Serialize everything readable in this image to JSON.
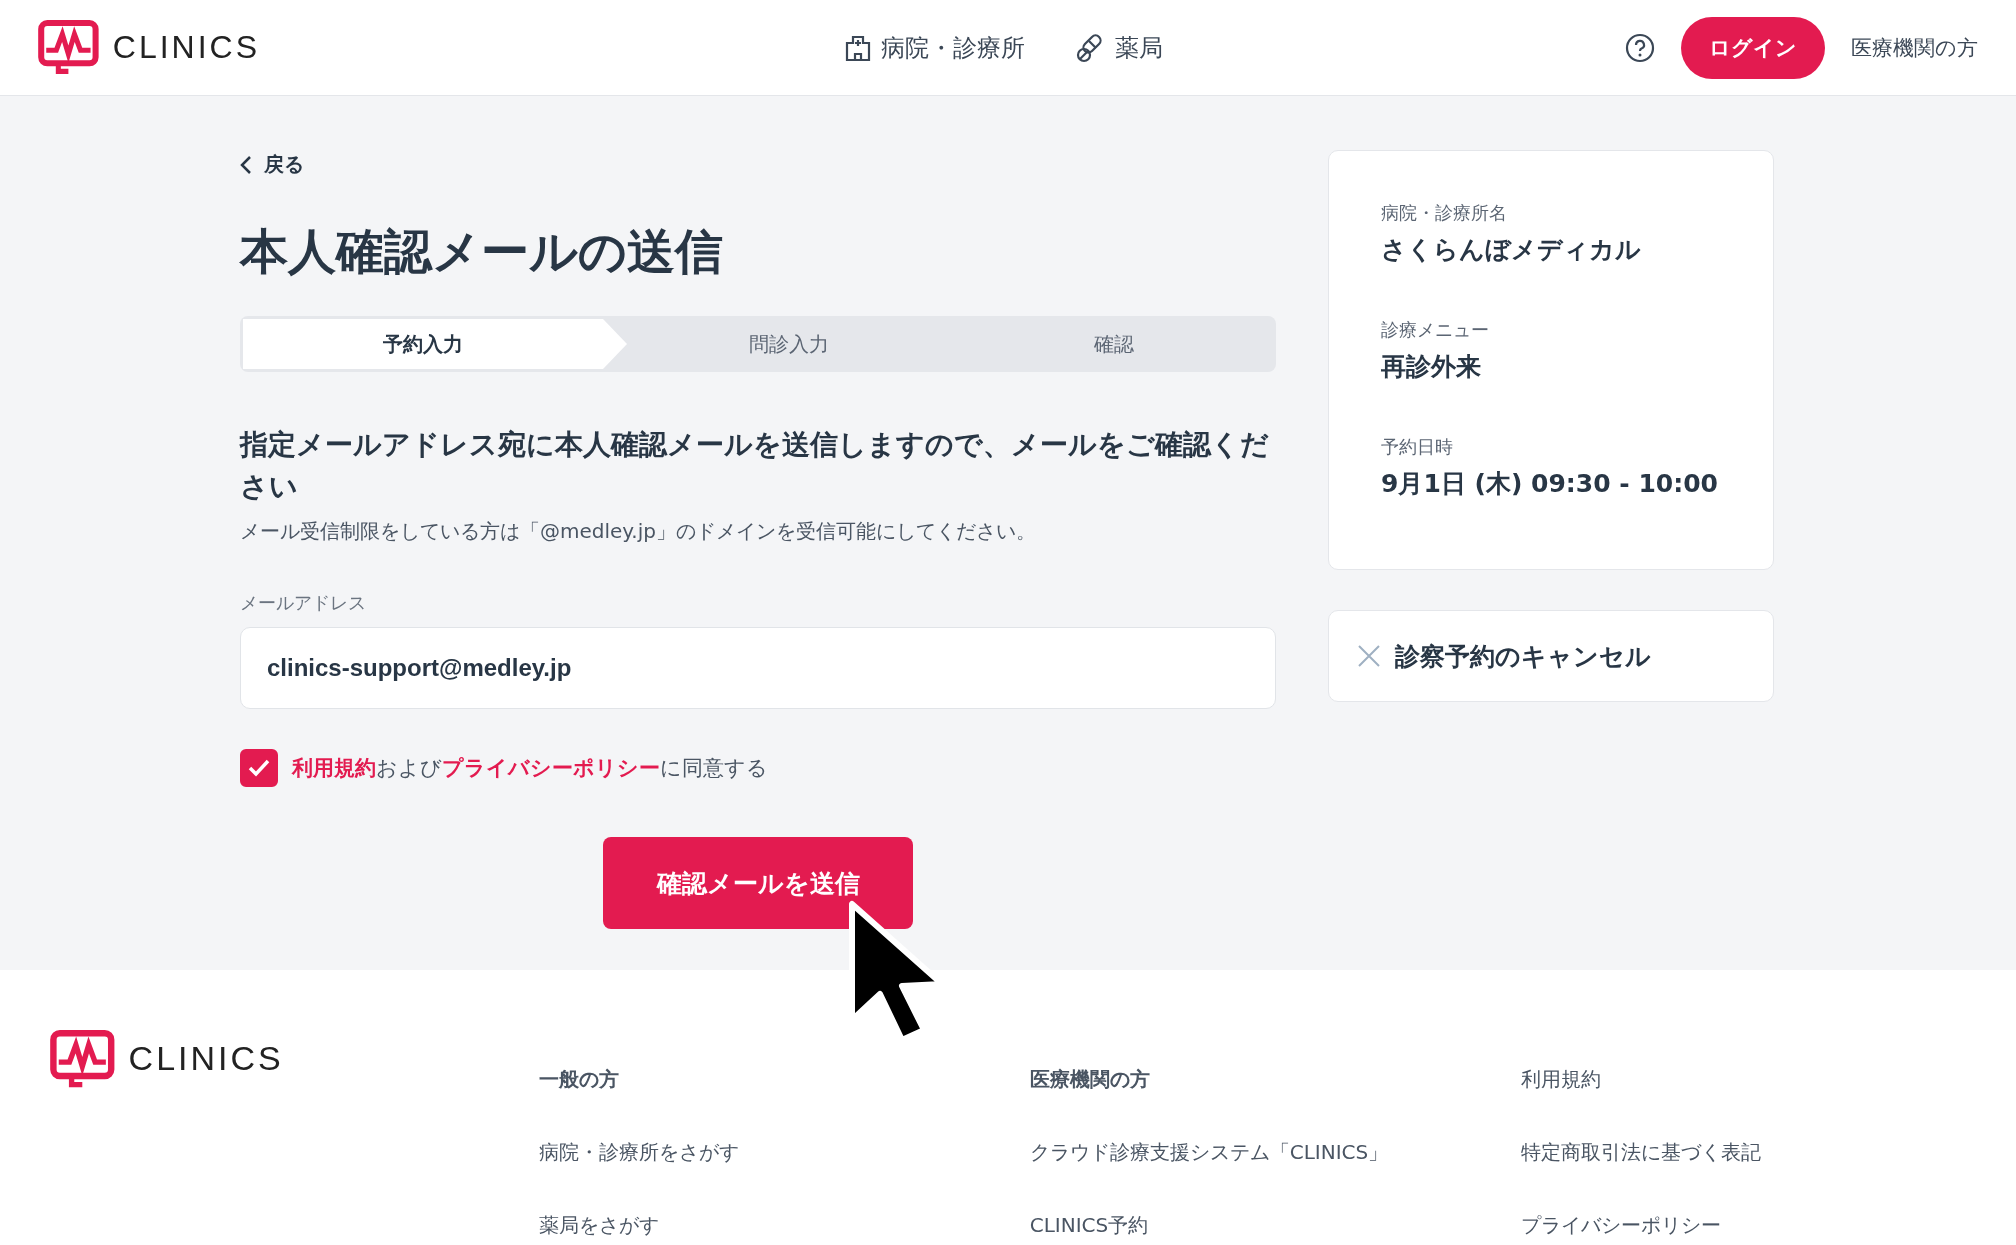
{
  "header": {
    "logo": "CLINICS",
    "nav": [
      {
        "label": "病院・診療所",
        "kind": "hospital"
      },
      {
        "label": "薬局",
        "kind": "pharmacy"
      }
    ],
    "login": "ログイン",
    "for_institutions": "医療機関の方"
  },
  "back": "戻る",
  "title": "本人確認メールの送信",
  "steps": [
    {
      "label": "予約入力",
      "selected": true
    },
    {
      "label": "問診入力",
      "selected": false
    },
    {
      "label": "確認",
      "selected": false
    }
  ],
  "message": "指定メールアドレス宛に本人確認メールを送信しますので、メールをご確認ください",
  "note": "メール受信制限をしている方は「@medley.jp」のドメインを受信可能にしてください。",
  "email": {
    "label": "メールアドレス",
    "value": "clinics-support@medley.jp"
  },
  "agree": {
    "checked": true,
    "parts": [
      {
        "text": "利用規約",
        "link": true
      },
      {
        "text": "および",
        "link": false
      },
      {
        "text": "プライバシーポリシー",
        "link": true
      },
      {
        "text": "に同意する",
        "link": false
      }
    ]
  },
  "submit": "確認メールを送信",
  "summary": [
    {
      "label": "病院・診療所名",
      "value": "さくらんぼメディカル"
    },
    {
      "label": "診療メニュー",
      "value": "再診外来"
    },
    {
      "label": "予約日時",
      "value": "9月1日 (木) 09:30 - 10:00"
    }
  ],
  "cancel": "診察予約のキャンセル",
  "footer": {
    "logo": "CLINICS",
    "columns": [
      {
        "heading": "一般の方",
        "links": [
          "病院・診療所をさがす",
          "薬局をさがす"
        ]
      },
      {
        "heading": "医療機関の方",
        "links": [
          "クラウド診療支援システム「CLINICS」",
          "CLINICS予約"
        ]
      },
      {
        "links": [
          "利用規約",
          "特定商取引法に基づく表記",
          "プライバシーポリシー"
        ]
      }
    ]
  }
}
